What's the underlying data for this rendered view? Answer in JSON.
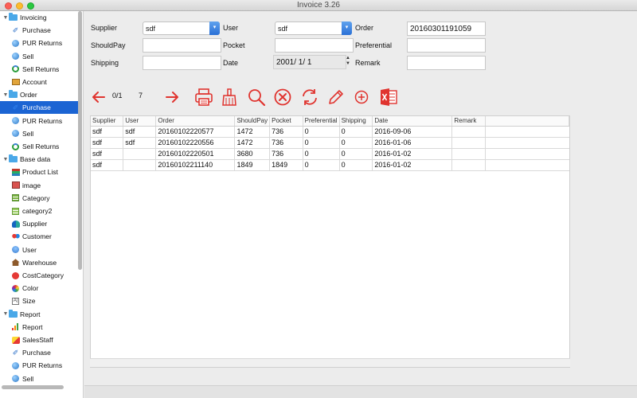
{
  "window": {
    "title": "Invoice 3.26"
  },
  "sidebar": {
    "items": [
      {
        "label": "Invoicing",
        "icon": "folder-icon",
        "kind": "group"
      },
      {
        "label": "Purchase",
        "icon": "cart-icon",
        "kind": "child"
      },
      {
        "label": "PUR Returns",
        "icon": "globe-icon",
        "kind": "child"
      },
      {
        "label": "Sell",
        "icon": "globe-icon",
        "kind": "child"
      },
      {
        "label": "Sell Returns",
        "icon": "refresh-icon",
        "kind": "child"
      },
      {
        "label": "Account",
        "icon": "account-icon",
        "kind": "child"
      },
      {
        "label": "Order",
        "icon": "folder-icon",
        "kind": "group"
      },
      {
        "label": "Purchase",
        "icon": "cart-icon",
        "kind": "child",
        "selected": true
      },
      {
        "label": "PUR Returns",
        "icon": "globe-icon",
        "kind": "child"
      },
      {
        "label": "Sell",
        "icon": "globe-icon",
        "kind": "child"
      },
      {
        "label": "Sell Returns",
        "icon": "refresh-icon",
        "kind": "child"
      },
      {
        "label": "Base data",
        "icon": "folder-icon",
        "kind": "group"
      },
      {
        "label": "Product List",
        "icon": "product-list-icon",
        "kind": "child"
      },
      {
        "label": "image",
        "icon": "image-icon",
        "kind": "child"
      },
      {
        "label": "Category",
        "icon": "category-icon",
        "kind": "child"
      },
      {
        "label": "category2",
        "icon": "category2-icon",
        "kind": "child"
      },
      {
        "label": "Supplier",
        "icon": "supplier-icon",
        "kind": "child"
      },
      {
        "label": "Customer",
        "icon": "customer-icon",
        "kind": "child"
      },
      {
        "label": "User",
        "icon": "user-icon",
        "kind": "child"
      },
      {
        "label": "Warehouse",
        "icon": "warehouse-icon",
        "kind": "child"
      },
      {
        "label": "CostCategory",
        "icon": "cost-category-icon",
        "kind": "child"
      },
      {
        "label": "Color",
        "icon": "color-icon",
        "kind": "child"
      },
      {
        "label": "Size",
        "icon": "size-icon",
        "kind": "child"
      },
      {
        "label": "Report",
        "icon": "folder-icon",
        "kind": "group"
      },
      {
        "label": "Report",
        "icon": "bar-chart-icon",
        "kind": "child"
      },
      {
        "label": "SalesStaff",
        "icon": "sales-staff-icon",
        "kind": "child"
      },
      {
        "label": "Purchase",
        "icon": "cart-icon",
        "kind": "child"
      },
      {
        "label": "PUR Returns",
        "icon": "globe-icon",
        "kind": "child"
      },
      {
        "label": "Sell",
        "icon": "globe-icon",
        "kind": "child"
      }
    ]
  },
  "form": {
    "supplier_label": "Supplier",
    "supplier_value": "sdf",
    "user_label": "User",
    "user_value": "sdf",
    "order_label": "Order",
    "order_value": "20160301191059",
    "shouldpay_label": "ShouldPay",
    "shouldpay_value": "",
    "pocket_label": "Pocket",
    "pocket_value": "",
    "preferential_label": "Preferential",
    "preferential_value": "",
    "shipping_label": "Shipping",
    "shipping_value": "",
    "date_label": "Date",
    "date_value": "2001/  1/  1",
    "remark_label": "Remark",
    "remark_value": ""
  },
  "toolbar": {
    "page_indicator": "0/1",
    "record_count": "7",
    "icons": [
      "prev-arrow-icon",
      "next-arrow-icon",
      "print-icon",
      "clear-broom-icon",
      "search-icon",
      "delete-icon",
      "refresh-icon",
      "edit-pencil-icon",
      "add-icon",
      "excel-export-icon"
    ],
    "accent_color": "#e0342f"
  },
  "table": {
    "columns": [
      "Supplier",
      "User",
      "Order",
      "ShouldPay",
      "Pocket",
      "Preferential",
      "Shipping",
      "Date",
      "Remark"
    ],
    "rows": [
      [
        "sdf",
        "sdf",
        "20160102220577",
        "1472",
        "736",
        "0",
        "0",
        "2016-09-06",
        ""
      ],
      [
        "sdf",
        "sdf",
        "20160102220556",
        "1472",
        "736",
        "0",
        "0",
        "2016-01-06",
        ""
      ],
      [
        "sdf",
        "",
        "20160102220501",
        "3680",
        "736",
        "0",
        "0",
        "2016-01-02",
        ""
      ],
      [
        "sdf",
        "",
        "20160102211140",
        "1849",
        "1849",
        "0",
        "0",
        "2016-01-02",
        ""
      ]
    ]
  }
}
